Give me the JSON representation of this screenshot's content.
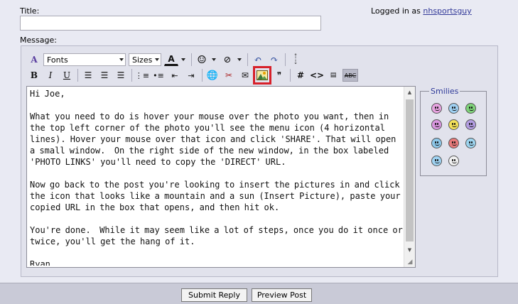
{
  "form": {
    "title_label": "Title:",
    "title_value": "",
    "logged_in_prefix": "Logged in as",
    "username": "nhsportsguy",
    "message_label": "Message:"
  },
  "toolbar": {
    "fonts_label": "Fonts",
    "sizes_label": "Sizes",
    "code_symbol": "#",
    "html_symbol": "<>",
    "highlighted_button": "insert-picture-button",
    "highlight_color": "#d7202a"
  },
  "message": {
    "body": "Hi Joe,\n\nWhat you need to do is hover your mouse over the photo you want, then in the top left corner of the photo you'll see the menu icon (4 horizontal lines). Hover your mouse over that icon and click 'SHARE'. That will open a small window.  On the right side of the new window, in the box labeled 'PHOTO LINKS' you'll need to copy the 'DIRECT' URL.\n\nNow go back to the post you're looking to insert the pictures in and click the icon that looks like a mountain and a sun (Insert Picture), paste your copied URL in the box that opens, and then hit ok.\n\nYou're done.  While it may seem like a lot of steps, once you do it once or twice, you'll get the hang of it.\n\nRyan"
  },
  "smilies": {
    "title": "Smilies",
    "items": [
      "smile-icon",
      "wink-icon",
      "grin-icon",
      "tongue-icon",
      "happy-icon",
      "angry-icon",
      "confused-icon",
      "mad-icon",
      "cool-icon",
      "sunglasses-icon",
      "eek-icon"
    ]
  },
  "actions": {
    "submit_label": "Submit Reply",
    "preview_label": "Preview Post"
  },
  "colors": {
    "page_bg": "#e9eaf3",
    "panel_bg": "#e1e2ec",
    "link": "#333a99"
  }
}
